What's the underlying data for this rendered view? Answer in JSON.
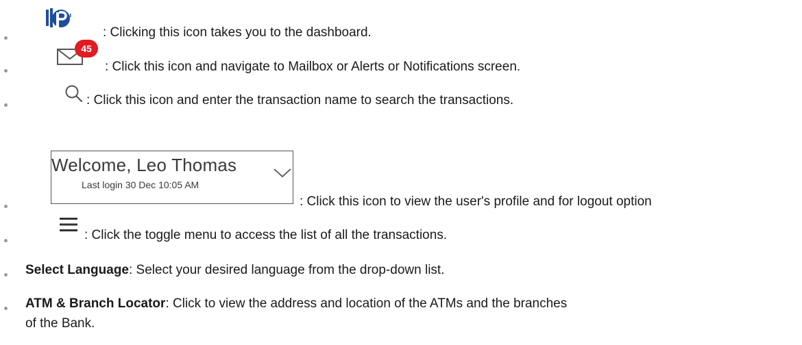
{
  "items": [
    {
      "text": ": Clicking this icon takes you to the dashboard."
    },
    {
      "text": ": Click this icon and navigate to Mailbox or Alerts or Notifications screen."
    },
    {
      "text": ": Click this icon and enter the transaction name to search the transactions."
    },
    {
      "text": ": Click this icon to view the user's profile and for logout option"
    },
    {
      "text": ": Click the toggle menu to access the list of all the transactions."
    },
    {
      "bold": "Select Language",
      "text": ": Select your desired language from the drop-down list."
    },
    {
      "bold": "ATM & Branch Locator",
      "text": ": Click to view the address and location of the ATMs and the branches",
      "text_cont": "of the Bank."
    }
  ],
  "mail_badge_count": "45",
  "welcome": {
    "greeting": "Welcome, Leo Thomas",
    "last_login": "Last login 30 Dec 10:05 AM"
  },
  "colors": {
    "logo_blue": "#1f4e9e",
    "badge_red": "#e01b22",
    "bullet_gray": "#9a9a9a"
  },
  "icons": [
    "logo-icon",
    "mail-icon",
    "search-icon",
    "chevron-down-icon",
    "hamburger-menu-icon"
  ]
}
